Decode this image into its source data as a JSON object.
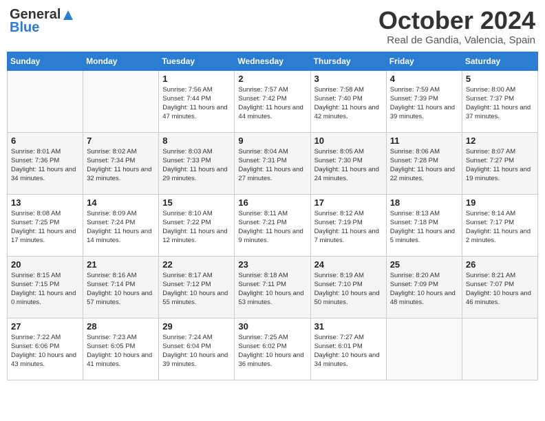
{
  "header": {
    "logo_line1": "General",
    "logo_line2": "Blue",
    "month": "October 2024",
    "location": "Real de Gandia, Valencia, Spain"
  },
  "weekdays": [
    "Sunday",
    "Monday",
    "Tuesday",
    "Wednesday",
    "Thursday",
    "Friday",
    "Saturday"
  ],
  "weeks": [
    [
      {
        "num": "",
        "sunrise": "",
        "sunset": "",
        "daylight": ""
      },
      {
        "num": "",
        "sunrise": "",
        "sunset": "",
        "daylight": ""
      },
      {
        "num": "1",
        "sunrise": "Sunrise: 7:56 AM",
        "sunset": "Sunset: 7:44 PM",
        "daylight": "Daylight: 11 hours and 47 minutes."
      },
      {
        "num": "2",
        "sunrise": "Sunrise: 7:57 AM",
        "sunset": "Sunset: 7:42 PM",
        "daylight": "Daylight: 11 hours and 44 minutes."
      },
      {
        "num": "3",
        "sunrise": "Sunrise: 7:58 AM",
        "sunset": "Sunset: 7:40 PM",
        "daylight": "Daylight: 11 hours and 42 minutes."
      },
      {
        "num": "4",
        "sunrise": "Sunrise: 7:59 AM",
        "sunset": "Sunset: 7:39 PM",
        "daylight": "Daylight: 11 hours and 39 minutes."
      },
      {
        "num": "5",
        "sunrise": "Sunrise: 8:00 AM",
        "sunset": "Sunset: 7:37 PM",
        "daylight": "Daylight: 11 hours and 37 minutes."
      }
    ],
    [
      {
        "num": "6",
        "sunrise": "Sunrise: 8:01 AM",
        "sunset": "Sunset: 7:36 PM",
        "daylight": "Daylight: 11 hours and 34 minutes."
      },
      {
        "num": "7",
        "sunrise": "Sunrise: 8:02 AM",
        "sunset": "Sunset: 7:34 PM",
        "daylight": "Daylight: 11 hours and 32 minutes."
      },
      {
        "num": "8",
        "sunrise": "Sunrise: 8:03 AM",
        "sunset": "Sunset: 7:33 PM",
        "daylight": "Daylight: 11 hours and 29 minutes."
      },
      {
        "num": "9",
        "sunrise": "Sunrise: 8:04 AM",
        "sunset": "Sunset: 7:31 PM",
        "daylight": "Daylight: 11 hours and 27 minutes."
      },
      {
        "num": "10",
        "sunrise": "Sunrise: 8:05 AM",
        "sunset": "Sunset: 7:30 PM",
        "daylight": "Daylight: 11 hours and 24 minutes."
      },
      {
        "num": "11",
        "sunrise": "Sunrise: 8:06 AM",
        "sunset": "Sunset: 7:28 PM",
        "daylight": "Daylight: 11 hours and 22 minutes."
      },
      {
        "num": "12",
        "sunrise": "Sunrise: 8:07 AM",
        "sunset": "Sunset: 7:27 PM",
        "daylight": "Daylight: 11 hours and 19 minutes."
      }
    ],
    [
      {
        "num": "13",
        "sunrise": "Sunrise: 8:08 AM",
        "sunset": "Sunset: 7:25 PM",
        "daylight": "Daylight: 11 hours and 17 minutes."
      },
      {
        "num": "14",
        "sunrise": "Sunrise: 8:09 AM",
        "sunset": "Sunset: 7:24 PM",
        "daylight": "Daylight: 11 hours and 14 minutes."
      },
      {
        "num": "15",
        "sunrise": "Sunrise: 8:10 AM",
        "sunset": "Sunset: 7:22 PM",
        "daylight": "Daylight: 11 hours and 12 minutes."
      },
      {
        "num": "16",
        "sunrise": "Sunrise: 8:11 AM",
        "sunset": "Sunset: 7:21 PM",
        "daylight": "Daylight: 11 hours and 9 minutes."
      },
      {
        "num": "17",
        "sunrise": "Sunrise: 8:12 AM",
        "sunset": "Sunset: 7:19 PM",
        "daylight": "Daylight: 11 hours and 7 minutes."
      },
      {
        "num": "18",
        "sunrise": "Sunrise: 8:13 AM",
        "sunset": "Sunset: 7:18 PM",
        "daylight": "Daylight: 11 hours and 5 minutes."
      },
      {
        "num": "19",
        "sunrise": "Sunrise: 8:14 AM",
        "sunset": "Sunset: 7:17 PM",
        "daylight": "Daylight: 11 hours and 2 minutes."
      }
    ],
    [
      {
        "num": "20",
        "sunrise": "Sunrise: 8:15 AM",
        "sunset": "Sunset: 7:15 PM",
        "daylight": "Daylight: 11 hours and 0 minutes."
      },
      {
        "num": "21",
        "sunrise": "Sunrise: 8:16 AM",
        "sunset": "Sunset: 7:14 PM",
        "daylight": "Daylight: 10 hours and 57 minutes."
      },
      {
        "num": "22",
        "sunrise": "Sunrise: 8:17 AM",
        "sunset": "Sunset: 7:12 PM",
        "daylight": "Daylight: 10 hours and 55 minutes."
      },
      {
        "num": "23",
        "sunrise": "Sunrise: 8:18 AM",
        "sunset": "Sunset: 7:11 PM",
        "daylight": "Daylight: 10 hours and 53 minutes."
      },
      {
        "num": "24",
        "sunrise": "Sunrise: 8:19 AM",
        "sunset": "Sunset: 7:10 PM",
        "daylight": "Daylight: 10 hours and 50 minutes."
      },
      {
        "num": "25",
        "sunrise": "Sunrise: 8:20 AM",
        "sunset": "Sunset: 7:09 PM",
        "daylight": "Daylight: 10 hours and 48 minutes."
      },
      {
        "num": "26",
        "sunrise": "Sunrise: 8:21 AM",
        "sunset": "Sunset: 7:07 PM",
        "daylight": "Daylight: 10 hours and 46 minutes."
      }
    ],
    [
      {
        "num": "27",
        "sunrise": "Sunrise: 7:22 AM",
        "sunset": "Sunset: 6:06 PM",
        "daylight": "Daylight: 10 hours and 43 minutes."
      },
      {
        "num": "28",
        "sunrise": "Sunrise: 7:23 AM",
        "sunset": "Sunset: 6:05 PM",
        "daylight": "Daylight: 10 hours and 41 minutes."
      },
      {
        "num": "29",
        "sunrise": "Sunrise: 7:24 AM",
        "sunset": "Sunset: 6:04 PM",
        "daylight": "Daylight: 10 hours and 39 minutes."
      },
      {
        "num": "30",
        "sunrise": "Sunrise: 7:25 AM",
        "sunset": "Sunset: 6:02 PM",
        "daylight": "Daylight: 10 hours and 36 minutes."
      },
      {
        "num": "31",
        "sunrise": "Sunrise: 7:27 AM",
        "sunset": "Sunset: 6:01 PM",
        "daylight": "Daylight: 10 hours and 34 minutes."
      },
      {
        "num": "",
        "sunrise": "",
        "sunset": "",
        "daylight": ""
      },
      {
        "num": "",
        "sunrise": "",
        "sunset": "",
        "daylight": ""
      }
    ]
  ]
}
